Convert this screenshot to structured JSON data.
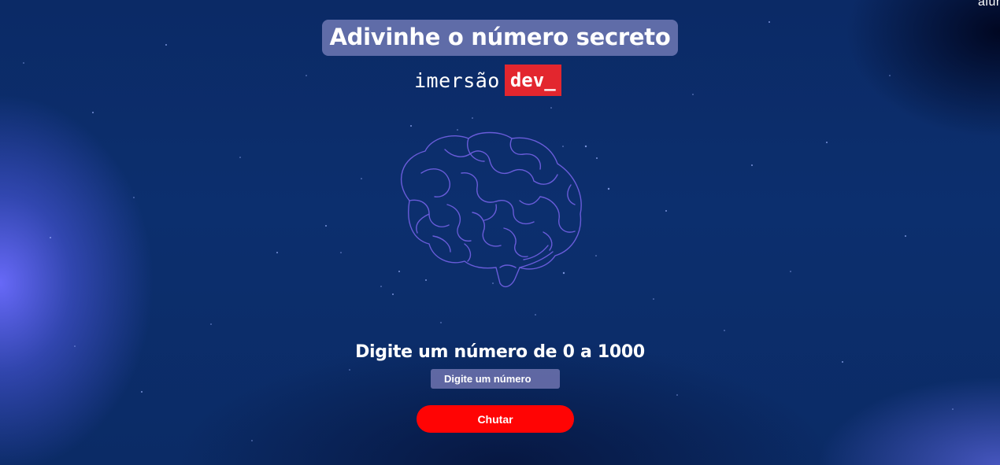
{
  "page": {
    "title": "Adivinhe o número secreto",
    "corner_logo": "alura"
  },
  "brand": {
    "text": "imersão",
    "badge": "dev_"
  },
  "game": {
    "prompt": "Digite um número de 0 a 1000",
    "input_placeholder": "Digite um número",
    "input_value": "",
    "guess_button_label": "Chutar"
  },
  "colors": {
    "background": "#0b2a66",
    "title_background": "#6e78b4",
    "brand_badge": "#e3262e",
    "button": "#ff0404",
    "brain_stroke": "#6f5fe0"
  },
  "icons": {
    "illustration": "brain-icon"
  }
}
